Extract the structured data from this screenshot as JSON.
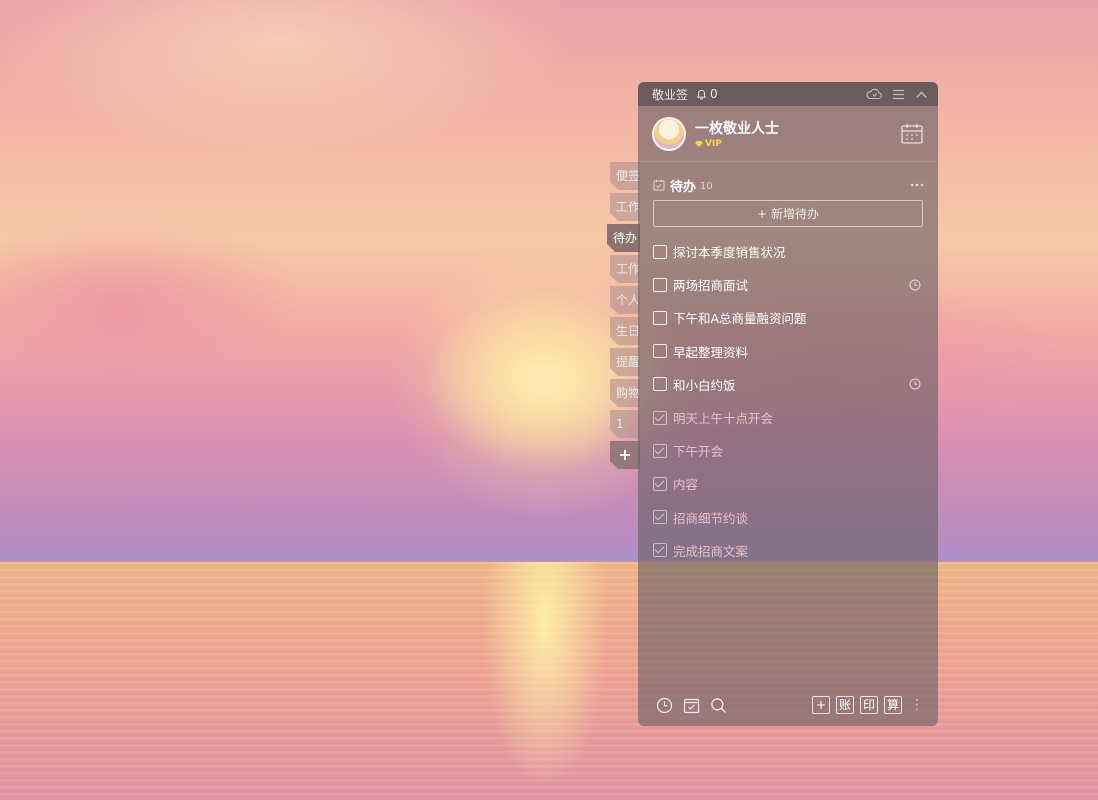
{
  "app": {
    "title": "敬业签",
    "notification_count": "0"
  },
  "user": {
    "name": "一枚敬业人士",
    "badge": "VIP"
  },
  "tabs": [
    {
      "label": "便签",
      "active": false
    },
    {
      "label": "工作",
      "active": false
    },
    {
      "label": "待办",
      "active": true
    },
    {
      "label": "工作",
      "active": false
    },
    {
      "label": "个人",
      "active": false
    },
    {
      "label": "生日",
      "active": false
    },
    {
      "label": "提醒",
      "active": false
    },
    {
      "label": "购物",
      "active": false
    },
    {
      "label": "1",
      "active": false
    },
    {
      "label": "+",
      "active": false
    }
  ],
  "section": {
    "title": "待办",
    "count": "10"
  },
  "new_todo_label": "新增待办",
  "todos": [
    {
      "text": "探讨本季度销售状况",
      "done": false,
      "reminder": false
    },
    {
      "text": "两场招商面试",
      "done": false,
      "reminder": true
    },
    {
      "text": "下午和A总商量融资问题",
      "done": false,
      "reminder": false
    },
    {
      "text": "早起整理资料",
      "done": false,
      "reminder": false
    },
    {
      "text": "和小白约饭",
      "done": false,
      "reminder": true
    },
    {
      "text": "明天上午十点开会",
      "done": true,
      "reminder": false
    },
    {
      "text": "下午开会",
      "done": true,
      "reminder": false
    },
    {
      "text": "内容",
      "done": true,
      "reminder": false
    },
    {
      "text": "招商细节约谈",
      "done": true,
      "reminder": false
    },
    {
      "text": "完成招商文案",
      "done": true,
      "reminder": false
    }
  ],
  "footer": {
    "left_icons": [
      "clock-icon",
      "checklist-icon",
      "search-icon"
    ],
    "buttons": [
      "+",
      "账",
      "印",
      "算"
    ]
  },
  "icons": {
    "bell": "bell-icon",
    "sync": "cloud-sync-icon",
    "menu": "menu-icon",
    "collapse": "chevron-up-icon",
    "calendar": "calendar-icon",
    "more": "more-dots-icon",
    "reminder": "clock-icon"
  }
}
